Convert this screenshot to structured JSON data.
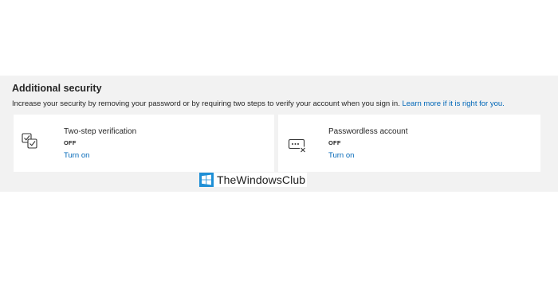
{
  "section": {
    "title": "Additional security",
    "description": "Increase your security by removing your password or by requiring two steps to verify your account when you sign in.",
    "learn_more": "Learn more if it is right for you."
  },
  "cards": [
    {
      "title": "Two-step verification",
      "status": "OFF",
      "action": "Turn on",
      "icon": "two-step-verification-icon"
    },
    {
      "title": "Passwordless account",
      "status": "OFF",
      "action": "Turn on",
      "icon": "passwordless-icon"
    }
  ],
  "watermark": {
    "text": "TheWindowsClub",
    "logo_color": "#1e8fd6"
  },
  "colors": {
    "link": "#0067b8",
    "section_background": "#f2f2f2"
  }
}
